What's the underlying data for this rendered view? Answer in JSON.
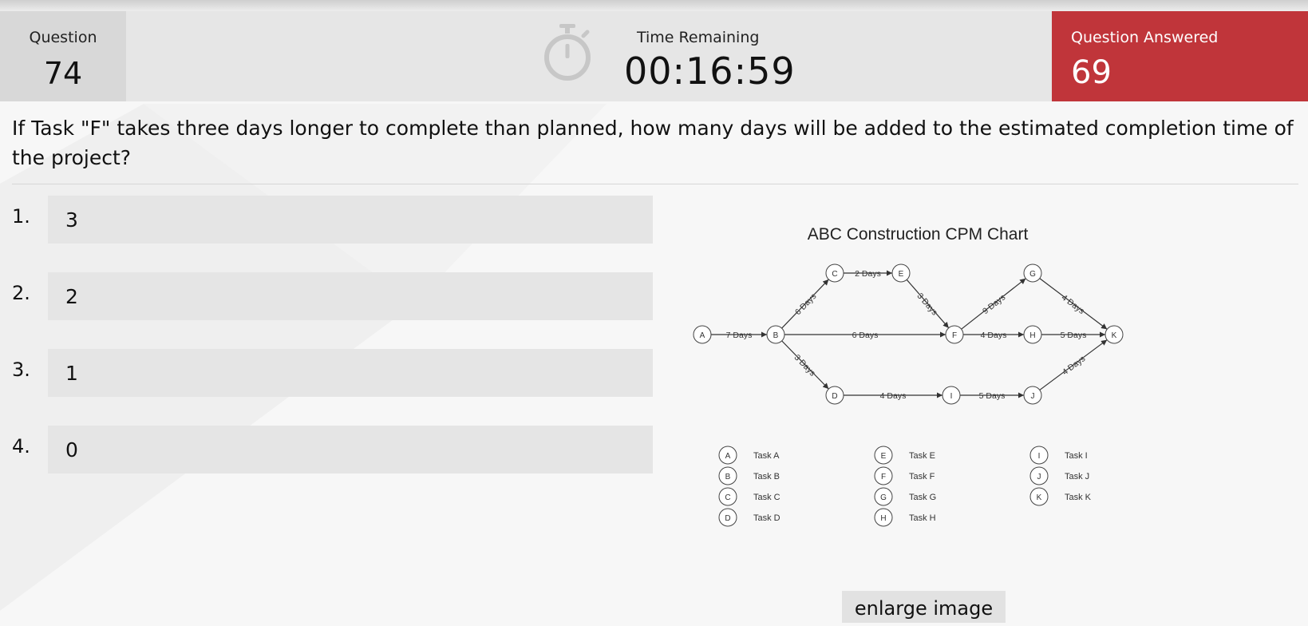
{
  "header": {
    "question_label": "Question",
    "question_number": "74",
    "time_label": "Time Remaining",
    "time_value": "00:16:59",
    "answered_label": "Question Answered",
    "answered_count": "69",
    "accent_color": "#c0353a"
  },
  "question": {
    "text": "If Task \"F\" takes three days longer to complete than planned, how many days will be added to the estimated completion time of the project?"
  },
  "options": [
    {
      "num": "1.",
      "text": "3"
    },
    {
      "num": "2.",
      "text": "2"
    },
    {
      "num": "3.",
      "text": "1"
    },
    {
      "num": "4.",
      "text": "0"
    }
  ],
  "diagram": {
    "title": "ABC Construction CPM Chart",
    "nodes": [
      "A",
      "B",
      "C",
      "D",
      "E",
      "F",
      "G",
      "H",
      "I",
      "J",
      "K"
    ],
    "edges": [
      {
        "from": "A",
        "to": "B",
        "label": "7 Days"
      },
      {
        "from": "B",
        "to": "C",
        "label": "6 Days"
      },
      {
        "from": "C",
        "to": "E",
        "label": "2 Days"
      },
      {
        "from": "E",
        "to": "F",
        "label": "3 Days"
      },
      {
        "from": "B",
        "to": "F",
        "label": "6 Days"
      },
      {
        "from": "B",
        "to": "D",
        "label": "3 Days"
      },
      {
        "from": "D",
        "to": "I",
        "label": "4 Days"
      },
      {
        "from": "I",
        "to": "J",
        "label": "5 Days"
      },
      {
        "from": "F",
        "to": "G",
        "label": "9 Days"
      },
      {
        "from": "F",
        "to": "H",
        "label": "4 Days"
      },
      {
        "from": "G",
        "to": "K",
        "label": "4 Days"
      },
      {
        "from": "H",
        "to": "K",
        "label": "5 Days"
      },
      {
        "from": "J",
        "to": "K",
        "label": "4 Days"
      }
    ],
    "legend": [
      {
        "node": "A",
        "task": "Task A"
      },
      {
        "node": "B",
        "task": "Task B"
      },
      {
        "node": "C",
        "task": "Task C"
      },
      {
        "node": "D",
        "task": "Task D"
      },
      {
        "node": "E",
        "task": "Task E"
      },
      {
        "node": "F",
        "task": "Task F"
      },
      {
        "node": "G",
        "task": "Task G"
      },
      {
        "node": "H",
        "task": "Task H"
      },
      {
        "node": "I",
        "task": "Task I"
      },
      {
        "node": "J",
        "task": "Task J"
      },
      {
        "node": "K",
        "task": "Task K"
      }
    ]
  },
  "actions": {
    "enlarge_label": "enlarge image"
  }
}
